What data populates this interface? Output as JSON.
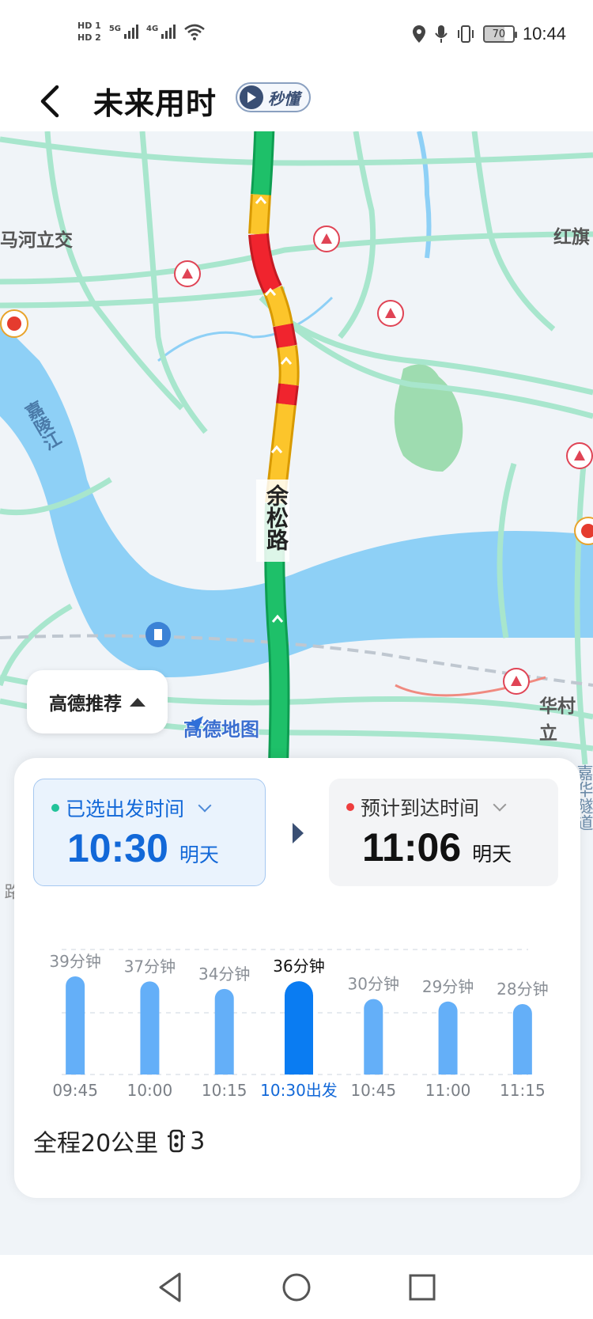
{
  "status_bar": {
    "hd1": "HD 1",
    "hd2": "HD 2",
    "net1": "5G",
    "net2": "4G",
    "battery": "70",
    "time": "10:44"
  },
  "header": {
    "title": "未来用时",
    "badge": "秒懂"
  },
  "map": {
    "road_label": "余松路",
    "place_labels": {
      "river": "嘉陵江",
      "interchange_left": "马河立交",
      "hongqi": "红旗",
      "huacun": "华村立",
      "right_edge_1": "嘉华隧道",
      "right_edge_2": "路"
    },
    "recommend_label": "高德推荐",
    "logo_text": "高德地图"
  },
  "departure": {
    "label": "已选出发时间",
    "time": "10:30",
    "day": "明天",
    "dot_color": "#22c39a"
  },
  "arrival": {
    "label": "预计到达时间",
    "time": "11:06",
    "day": "明天",
    "dot_color": "#ee3e3e"
  },
  "chart_data": {
    "type": "bar",
    "categories": [
      "09:45",
      "10:00",
      "10:15",
      "10:30出发",
      "10:45",
      "11:00",
      "11:15"
    ],
    "values": [
      39,
      37,
      34,
      36,
      30,
      29,
      28
    ],
    "value_labels": [
      "39分钟",
      "37分钟",
      "34分钟",
      "36分钟",
      "30分钟",
      "29分钟",
      "28分钟"
    ],
    "selected_index": 3,
    "unit": "分钟",
    "colors": {
      "normal": "#64aff8",
      "selected": "#0a7cf2"
    }
  },
  "summary": {
    "distance_text": "全程20公里",
    "traffic_lights": "3"
  },
  "accent_color": "#1268d8"
}
